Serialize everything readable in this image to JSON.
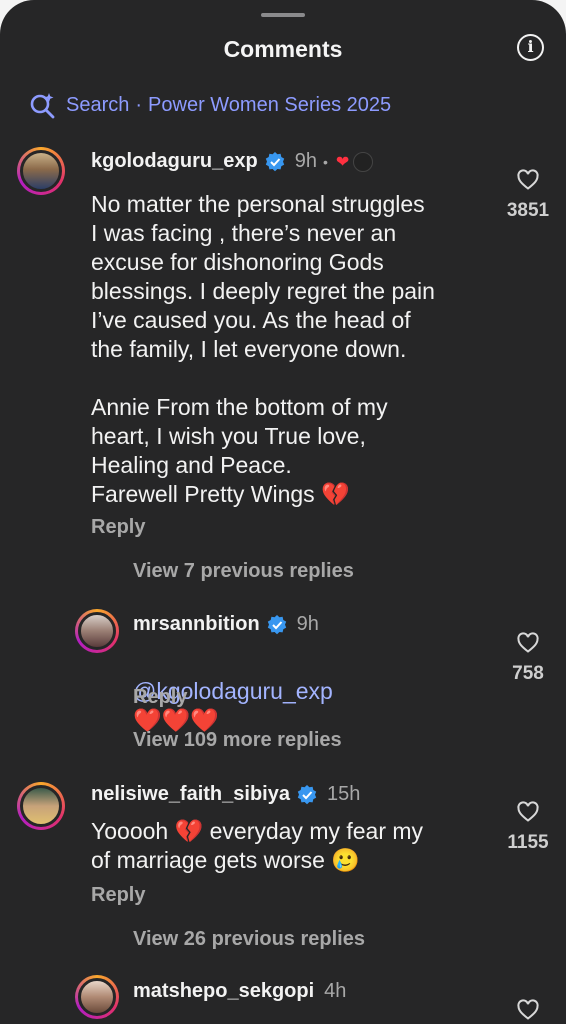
{
  "header": {
    "title": "Comments",
    "info_icon": "info-icon"
  },
  "search": {
    "label": "Search",
    "separator": "·",
    "query": "Power Women Series 2025"
  },
  "comments": [
    {
      "username": "kgolodaguru_exp",
      "time": "9h",
      "bullet": "•",
      "body": "No matter the personal struggles\nI was facing , there’s never an\nexcuse for dishonoring Gods\nblessings. I deeply regret the pain\nI’ve caused you. As the head of\nthe family, I let everyone down.\n\nAnnie From the bottom of my\nheart, I wish you True love,\nHealing and Peace.\nFarewell Pretty Wings 💔",
      "reply_label": "Reply",
      "likes": "3851",
      "view_replies": "View 7 previous replies"
    },
    {
      "username": "mrsannbition",
      "time": "9h",
      "mention": "@kgolodaguru_exp",
      "emojis": "❤️❤️❤️",
      "reply_label": "Reply",
      "likes": "758",
      "view_replies": "View 109 more replies"
    },
    {
      "username": "nelisiwe_faith_sibiya",
      "time": "15h",
      "body": "Yooooh 💔 everyday my fear my\nof marriage gets worse 🥲",
      "reply_label": "Reply",
      "likes": "1155",
      "view_replies": "View 26 previous replies"
    },
    {
      "username": "matshepo_sekgopi",
      "time": "4h"
    }
  ],
  "colors": {
    "background": "#262627",
    "accent": "#8d9bff",
    "verified": "#3897f0",
    "heart": "#ff3040"
  }
}
